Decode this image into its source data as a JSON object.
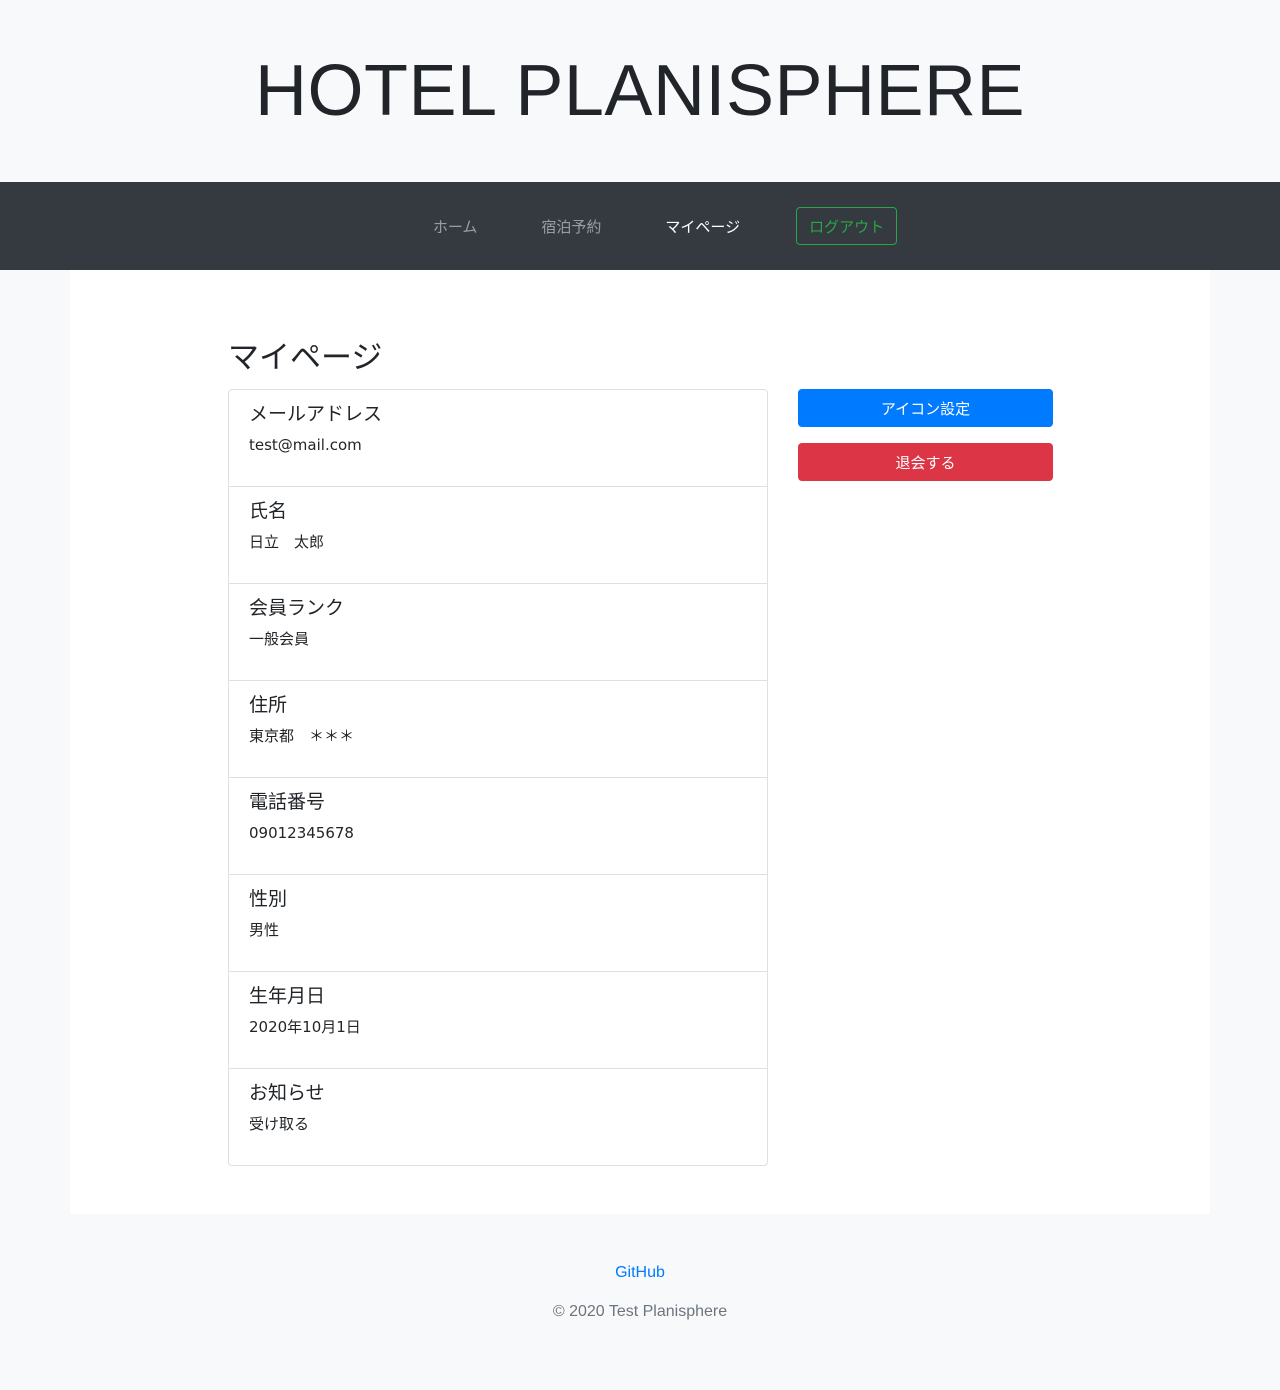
{
  "site": {
    "title": "HOTEL PLANISPHERE"
  },
  "nav": {
    "home": "ホーム",
    "reserve": "宿泊予約",
    "mypage": "マイページ",
    "logout": "ログアウト"
  },
  "main": {
    "heading": "マイページ",
    "items": [
      {
        "label": "メールアドレス",
        "value": "test@mail.com"
      },
      {
        "label": "氏名",
        "value": "日立　太郎"
      },
      {
        "label": "会員ランク",
        "value": "一般会員"
      },
      {
        "label": "住所",
        "value": "東京都　＊＊＊"
      },
      {
        "label": "電話番号",
        "value": "09012345678"
      },
      {
        "label": "性別",
        "value": "男性"
      },
      {
        "label": "生年月日",
        "value": "2020年10月1日"
      },
      {
        "label": "お知らせ",
        "value": "受け取る"
      }
    ],
    "actions": {
      "icon_settings": "アイコン設定",
      "withdraw": "退会する"
    }
  },
  "footer": {
    "github": "GitHub",
    "copyright": "© 2020 Test Planisphere"
  },
  "colors": {
    "primary": "#007bff",
    "danger": "#dc3545",
    "success": "#28a745",
    "navbar": "#343a40"
  }
}
